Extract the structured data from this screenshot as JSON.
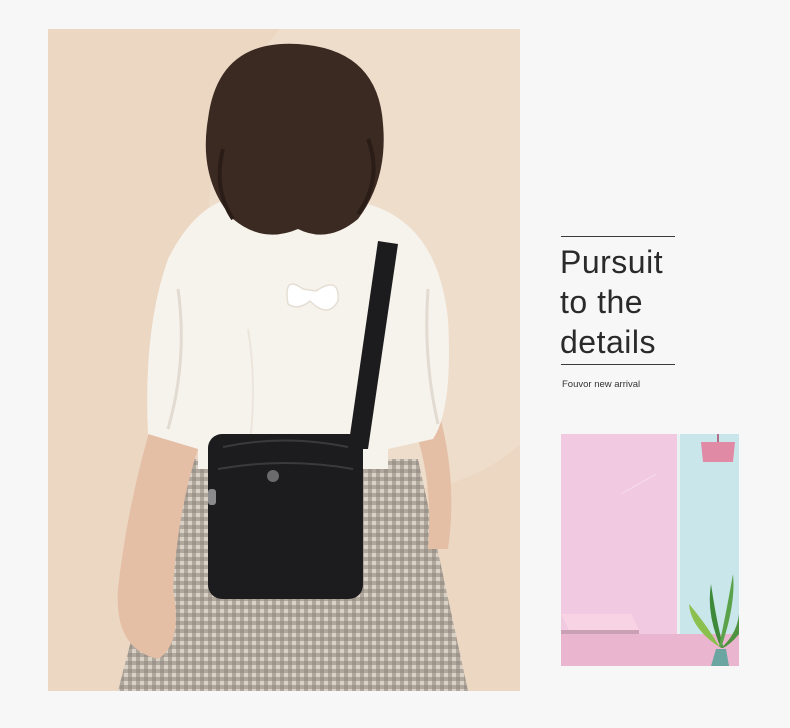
{
  "headline": {
    "line1": "Pursuit",
    "line2": "to the",
    "line3": "details"
  },
  "caption": "Fouvor new arrival",
  "colors": {
    "page_background": "#f7f7f7",
    "main_photo_background": "#ecd7c2",
    "rule_color": "#3a3a3a",
    "text_color": "#2a2a2a",
    "room_pink": "#efc6dd",
    "room_teal": "#c9e6ea",
    "bag_black": "#1c1c1e",
    "blouse_white": "#f6f2ec"
  }
}
